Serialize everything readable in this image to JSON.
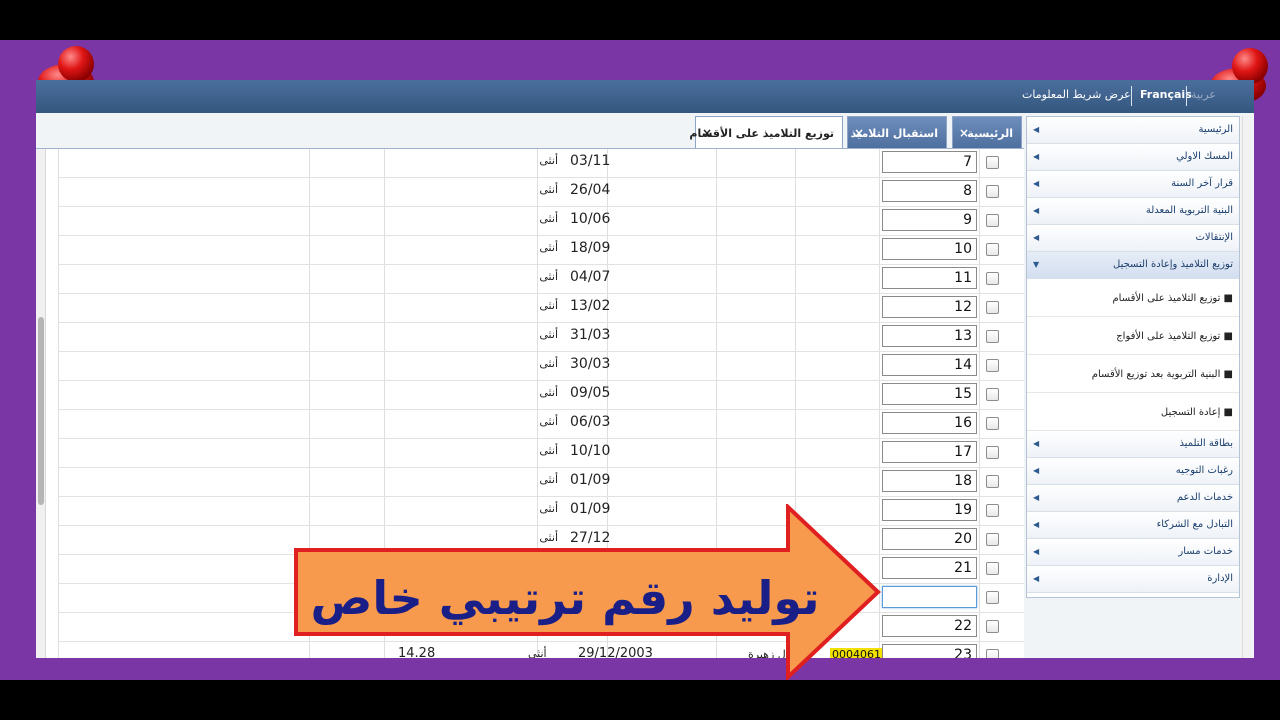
{
  "topbar": {
    "info_bar_label": "عرض شريط المعلومات",
    "lang_fr": "Français",
    "lang_ar": "عربية"
  },
  "tabs": [
    {
      "label": "الرئيسية",
      "close": "×"
    },
    {
      "label": "استقبال التلاميذ",
      "close": "×"
    },
    {
      "label": "توزيع التلاميذ على الأقسام",
      "close": "×"
    }
  ],
  "table": {
    "rows": [
      {
        "num": "7",
        "date": "03/11",
        "gender": "أنثى"
      },
      {
        "num": "8",
        "date": "26/04",
        "gender": "أنثى"
      },
      {
        "num": "9",
        "date": "10/06",
        "gender": "أنثى"
      },
      {
        "num": "10",
        "date": "18/09",
        "gender": "أنثى"
      },
      {
        "num": "11",
        "date": "04/07",
        "gender": "أنثى"
      },
      {
        "num": "12",
        "date": "13/02",
        "gender": "أنثى"
      },
      {
        "num": "13",
        "date": "31/03",
        "gender": "أنثى"
      },
      {
        "num": "14",
        "date": "30/03",
        "gender": "أنثى"
      },
      {
        "num": "15",
        "date": "09/05",
        "gender": "أنثى"
      },
      {
        "num": "16",
        "date": "06/03",
        "gender": "أنثى"
      },
      {
        "num": "17",
        "date": "10/10",
        "gender": "أنثى"
      },
      {
        "num": "18",
        "date": "01/09",
        "gender": "أنثى"
      },
      {
        "num": "19",
        "date": "01/09",
        "gender": "أنثى"
      },
      {
        "num": "20",
        "date": "27/12",
        "gender": "أنثى"
      },
      {
        "num": "21",
        "date": "",
        "gender": ""
      },
      {
        "num": "",
        "date": "",
        "gender": ""
      },
      {
        "num": "22",
        "date": "",
        "gender": ""
      }
    ],
    "bottom_row": {
      "num": "23",
      "student_id": "00040615",
      "name": "بشلال زهيرة",
      "birth_date": "29/12/2003",
      "gender": "أنثى",
      "score": "14.28"
    }
  },
  "sidebar": {
    "items_top": [
      "الرئيسية",
      "المسك الاولي",
      "قرار آخر السنة",
      "البنية التربوية المعدلة",
      "الإنتقالات"
    ],
    "open_item": "توزيع التلاميذ وإعادة التسجيل",
    "sub_items": [
      "توزيع التلاميذ على الأقسام",
      "توزيع التلاميذ على الأفواج",
      "البنية التربوية بعد توزيع الأقسام",
      "إعادة التسجيل"
    ],
    "items_bottom": [
      "بطاقة التلميذ",
      "رغبات التوجيه",
      "خدمات الدعم",
      "التبادل مع الشركاء",
      "خدمات مسار",
      "الإدارة"
    ],
    "arrow": "◀",
    "arrow_open": "▼",
    "bullet": "■"
  },
  "banner": {
    "text": "توليد رقم ترتيبي خاص",
    "fill_color": "#f79a4e",
    "border_color": "#e02020",
    "text_color": "#1a1f87"
  },
  "colors": {
    "frame_purple": "#7a36a4",
    "topbar_blue": "#3c5f8c",
    "highlight_yellow": "#f2e100"
  }
}
